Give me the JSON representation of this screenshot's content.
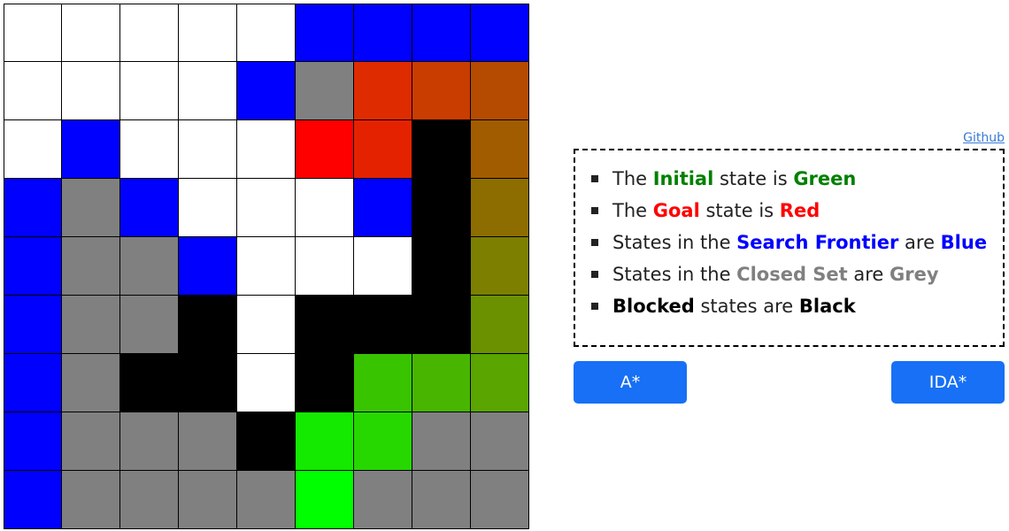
{
  "colors": {
    "white": "#ffffff",
    "blue": "#0000ff",
    "grey": "#808080",
    "black": "#000000",
    "green": "#008000",
    "red": "#ff0000"
  },
  "grid": {
    "rows": 9,
    "cols": 9,
    "cells": [
      [
        "#ffffff",
        "#ffffff",
        "#ffffff",
        "#ffffff",
        "#ffffff",
        "#0000ff",
        "#0000ff",
        "#0000ff",
        "#0000ff"
      ],
      [
        "#ffffff",
        "#ffffff",
        "#ffffff",
        "#ffffff",
        "#0000ff",
        "#808080",
        "#df2b00",
        "#c93d00",
        "#b44b00"
      ],
      [
        "#ffffff",
        "#0000ff",
        "#ffffff",
        "#ffffff",
        "#ffffff",
        "#ff0000",
        "#e52200",
        "#000000",
        "#a25c00"
      ],
      [
        "#0000ff",
        "#808080",
        "#0000ff",
        "#ffffff",
        "#ffffff",
        "#ffffff",
        "#0000ff",
        "#000000",
        "#8d6d00"
      ],
      [
        "#0000ff",
        "#808080",
        "#808080",
        "#0000ff",
        "#ffffff",
        "#ffffff",
        "#ffffff",
        "#000000",
        "#7c7f00"
      ],
      [
        "#0000ff",
        "#808080",
        "#808080",
        "#000000",
        "#ffffff",
        "#000000",
        "#000000",
        "#000000",
        "#6b9100"
      ],
      [
        "#0000ff",
        "#808080",
        "#000000",
        "#000000",
        "#ffffff",
        "#000000",
        "#39c400",
        "#48b500",
        "#5aa500"
      ],
      [
        "#0000ff",
        "#808080",
        "#808080",
        "#808080",
        "#000000",
        "#14e900",
        "#26d800",
        "#808080",
        "#808080"
      ],
      [
        "#0000ff",
        "#808080",
        "#808080",
        "#808080",
        "#808080",
        "#00ff00",
        "#808080",
        "#808080",
        "#808080"
      ]
    ]
  },
  "github_link": "Github",
  "legend": [
    {
      "parts": [
        {
          "text": "The ",
          "color": "#222222",
          "bold": false
        },
        {
          "text": "Initial",
          "color": "#008000",
          "bold": true
        },
        {
          "text": " state is ",
          "color": "#222222",
          "bold": false
        },
        {
          "text": "Green",
          "color": "#008000",
          "bold": true
        }
      ]
    },
    {
      "parts": [
        {
          "text": "The ",
          "color": "#222222",
          "bold": false
        },
        {
          "text": "Goal",
          "color": "#ff0000",
          "bold": true
        },
        {
          "text": " state is ",
          "color": "#222222",
          "bold": false
        },
        {
          "text": "Red",
          "color": "#ff0000",
          "bold": true
        }
      ]
    },
    {
      "parts": [
        {
          "text": "States in the ",
          "color": "#222222",
          "bold": false
        },
        {
          "text": "Search Frontier",
          "color": "#0000ff",
          "bold": true
        },
        {
          "text": " are ",
          "color": "#222222",
          "bold": false
        },
        {
          "text": "Blue",
          "color": "#0000ff",
          "bold": true
        }
      ]
    },
    {
      "parts": [
        {
          "text": "States in the ",
          "color": "#222222",
          "bold": false
        },
        {
          "text": "Closed Set",
          "color": "#808080",
          "bold": true
        },
        {
          "text": " are ",
          "color": "#222222",
          "bold": false
        },
        {
          "text": "Grey",
          "color": "#808080",
          "bold": true
        }
      ]
    },
    {
      "parts": [
        {
          "text": "Blocked",
          "color": "#000000",
          "bold": true
        },
        {
          "text": " states are ",
          "color": "#222222",
          "bold": false
        },
        {
          "text": "Black",
          "color": "#000000",
          "bold": true
        }
      ]
    }
  ],
  "buttons": {
    "astar_label": "A*",
    "idastar_label": "IDA*",
    "color": "#1770f5"
  }
}
